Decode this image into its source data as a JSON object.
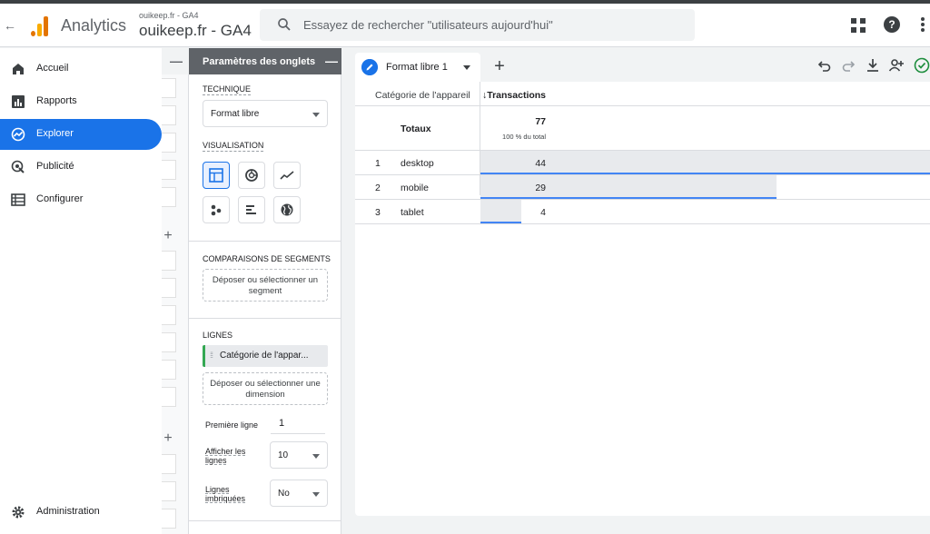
{
  "header": {
    "app_name": "Analytics",
    "account_small": "ouikeep.fr - GA4",
    "account_main": "ouikeep.fr  - GA4",
    "search_placeholder": "Essayez de rechercher \"utilisateurs aujourd'hui\""
  },
  "nav": {
    "items": [
      {
        "label": "Accueil",
        "icon": "home-icon"
      },
      {
        "label": "Rapports",
        "icon": "bar-chart-icon"
      },
      {
        "label": "Explorer",
        "icon": "explore-icon",
        "active": true
      },
      {
        "label": "Publicité",
        "icon": "ads-icon"
      },
      {
        "label": "Configurer",
        "icon": "list-icon"
      }
    ],
    "admin_label": "Administration"
  },
  "tab_settings": {
    "title": "Paramètres des onglets",
    "technique_label": "TECHNIQUE",
    "technique_value": "Format libre",
    "visualisation_label": "VISUALISATION",
    "segments_label": "COMPARAISONS DE SEGMENTS",
    "segments_drop": "Déposer ou sélectionner un segment",
    "lignes_label": "LIGNES",
    "lignes_chip": "Catégorie de l'appar...",
    "lignes_drop": "Déposer ou sélectionner une dimension",
    "premiere_ligne_label": "Première ligne",
    "premiere_ligne_value": "1",
    "afficher_lignes_label": "Afficher les lignes",
    "afficher_lignes_value": "10",
    "lignes_imbriquees_label": "Lignes imbriquées",
    "lignes_imbriquees_value": "No"
  },
  "canvas": {
    "tab_name": "Format libre 1",
    "dimension_header": "Catégorie de l'appareil",
    "metric_header": "↓Transactions",
    "totals_label": "Totaux",
    "totals_value": "77",
    "totals_sub": "100 % du total",
    "rows": [
      {
        "index": "1",
        "category": "desktop",
        "value": "44"
      },
      {
        "index": "2",
        "category": "mobile",
        "value": "29"
      },
      {
        "index": "3",
        "category": "tablet",
        "value": "4"
      }
    ]
  },
  "chart_data": {
    "type": "table",
    "columns": [
      "Catégorie de l'appareil",
      "Transactions"
    ],
    "categories": [
      "desktop",
      "mobile",
      "tablet"
    ],
    "values": [
      44,
      29,
      4
    ],
    "total": 77
  },
  "colors": {
    "accent": "#1a73e8",
    "bar": "#e8eaed",
    "bar_line": "#4285f4",
    "chip_green": "#34a853"
  }
}
